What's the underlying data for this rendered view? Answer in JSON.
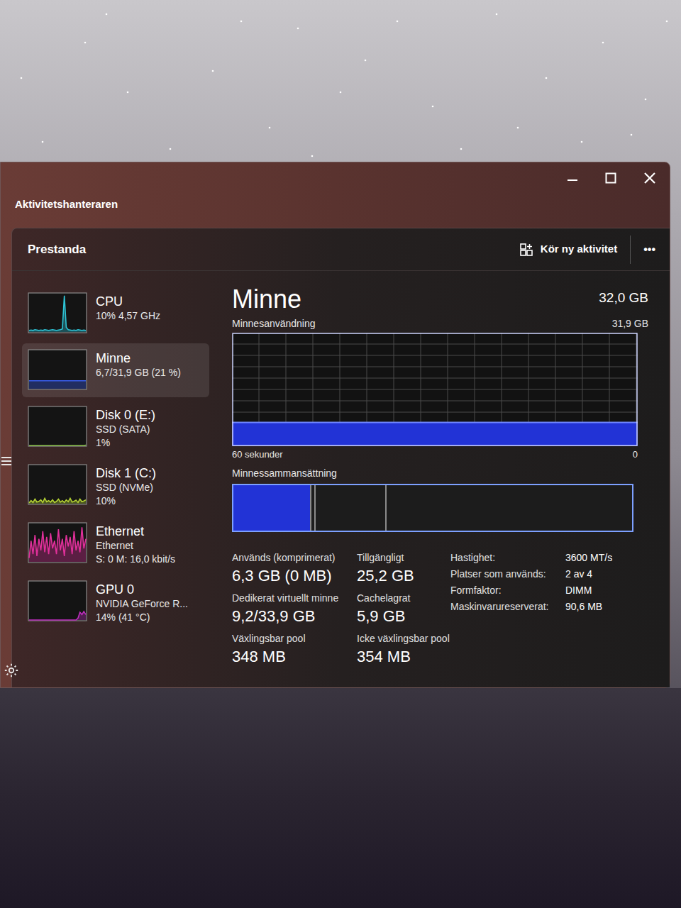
{
  "window": {
    "title": "Aktivitetshanteraren"
  },
  "header": {
    "title": "Prestanda",
    "run_task": "Kör ny aktivitet",
    "more": "•••"
  },
  "sidebar": {
    "items": [
      {
        "name": "CPU",
        "lines": [
          "10% 4,57 GHz"
        ],
        "selected": false,
        "color": "#2ec4d6",
        "graph": [
          4,
          5,
          4,
          6,
          5,
          4,
          5,
          4,
          6,
          5,
          4,
          5,
          6,
          5,
          4,
          5,
          6,
          8,
          95,
          12,
          6,
          5,
          4,
          5,
          4,
          6,
          5,
          4,
          5,
          4
        ]
      },
      {
        "name": "Minne",
        "lines": [
          "6,7/31,9 GB (21 %)"
        ],
        "selected": true,
        "color": "#3a5ff0",
        "graph": [
          21,
          21,
          21,
          21,
          21,
          21,
          21,
          21,
          21,
          21,
          21,
          21,
          21,
          21,
          21,
          21,
          21,
          21,
          21,
          21,
          21,
          21,
          21,
          21,
          21,
          21,
          21,
          21,
          21,
          21
        ]
      },
      {
        "name": "Disk 0 (E:)",
        "lines": [
          "SSD (SATA)",
          "1%"
        ],
        "selected": false,
        "color": "#8bc34a",
        "graph": [
          0,
          0,
          0,
          0,
          0,
          0,
          0,
          0,
          0,
          0,
          0,
          0,
          0,
          0,
          0,
          0,
          0,
          0,
          0,
          0,
          0,
          0,
          0,
          0,
          0,
          0,
          0,
          0,
          0,
          1
        ]
      },
      {
        "name": "Disk 1 (C:)",
        "lines": [
          "SSD (NVMe)",
          "10%"
        ],
        "selected": false,
        "color": "#b5d334",
        "graph": [
          2,
          8,
          3,
          12,
          4,
          6,
          10,
          3,
          14,
          5,
          8,
          4,
          10,
          3,
          6,
          12,
          4,
          8,
          3,
          10,
          5,
          14,
          4,
          6,
          9,
          3,
          12,
          5,
          7,
          10
        ]
      },
      {
        "name": "Ethernet",
        "lines": [
          "Ethernet",
          "S: 0 M: 16,0 kbit/s"
        ],
        "selected": false,
        "color": "#e0309a",
        "graph": [
          10,
          55,
          20,
          70,
          15,
          60,
          30,
          80,
          25,
          65,
          20,
          75,
          35,
          55,
          20,
          85,
          30,
          60,
          15,
          70,
          40,
          65,
          20,
          80,
          30,
          55,
          25,
          90,
          35,
          60
        ]
      },
      {
        "name": "GPU 0",
        "lines": [
          "NVIDIA GeForce R...",
          "14% (41 °C)"
        ],
        "selected": false,
        "color": "#c02ec0",
        "graph": [
          0,
          0,
          0,
          0,
          0,
          0,
          0,
          0,
          0,
          0,
          0,
          0,
          0,
          0,
          0,
          0,
          0,
          0,
          0,
          0,
          0,
          0,
          0,
          0,
          0,
          5,
          20,
          14,
          22,
          14
        ]
      }
    ]
  },
  "detail": {
    "title": "Minne",
    "total": "32,0 GB",
    "usage_label": "Minnesanvändning",
    "usage_max": "31,9 GB",
    "usage_graph": {
      "values": [
        21,
        21,
        21,
        21,
        21,
        21,
        21,
        21,
        21,
        21,
        21,
        21,
        21,
        21,
        21,
        21,
        21,
        21,
        21,
        21,
        21,
        21,
        21,
        21,
        21,
        21,
        21,
        21,
        21,
        21
      ],
      "color": "#2233d6"
    },
    "x_label": "60 sekunder",
    "y_min": "0",
    "composition_label": "Minnessammansättning",
    "composition": [
      {
        "name": "in-use",
        "level": 0.195,
        "color": "#2233d6"
      },
      {
        "name": "modified",
        "level": 0.012,
        "color": "#1c1c1c"
      },
      {
        "name": "standby",
        "level": 0.178,
        "color": "#1c1c1c"
      },
      {
        "name": "free",
        "level": 0.615,
        "color": "#1c1c1c"
      }
    ],
    "stats": [
      {
        "label": "Används (komprimerat)",
        "value": "6,3 GB (0 MB)"
      },
      {
        "label": "Tillgängligt",
        "value": "25,2 GB"
      },
      {
        "label": "Dedikerat virtuellt minne",
        "value": "9,2/33,9 GB"
      },
      {
        "label": "Cachelagrat",
        "value": "5,9 GB"
      },
      {
        "label": "Växlingsbar pool",
        "value": "348 MB"
      },
      {
        "label": "Icke växlingsbar pool",
        "value": "354 MB"
      }
    ],
    "specs": [
      {
        "label": "Hastighet:",
        "value": "3600 MT/s"
      },
      {
        "label": "Platser som används:",
        "value": "2 av 4"
      },
      {
        "label": "Formfaktor:",
        "value": "DIMM"
      },
      {
        "label": "Maskinvarureserverat:",
        "value": "90,6 MB"
      }
    ]
  }
}
